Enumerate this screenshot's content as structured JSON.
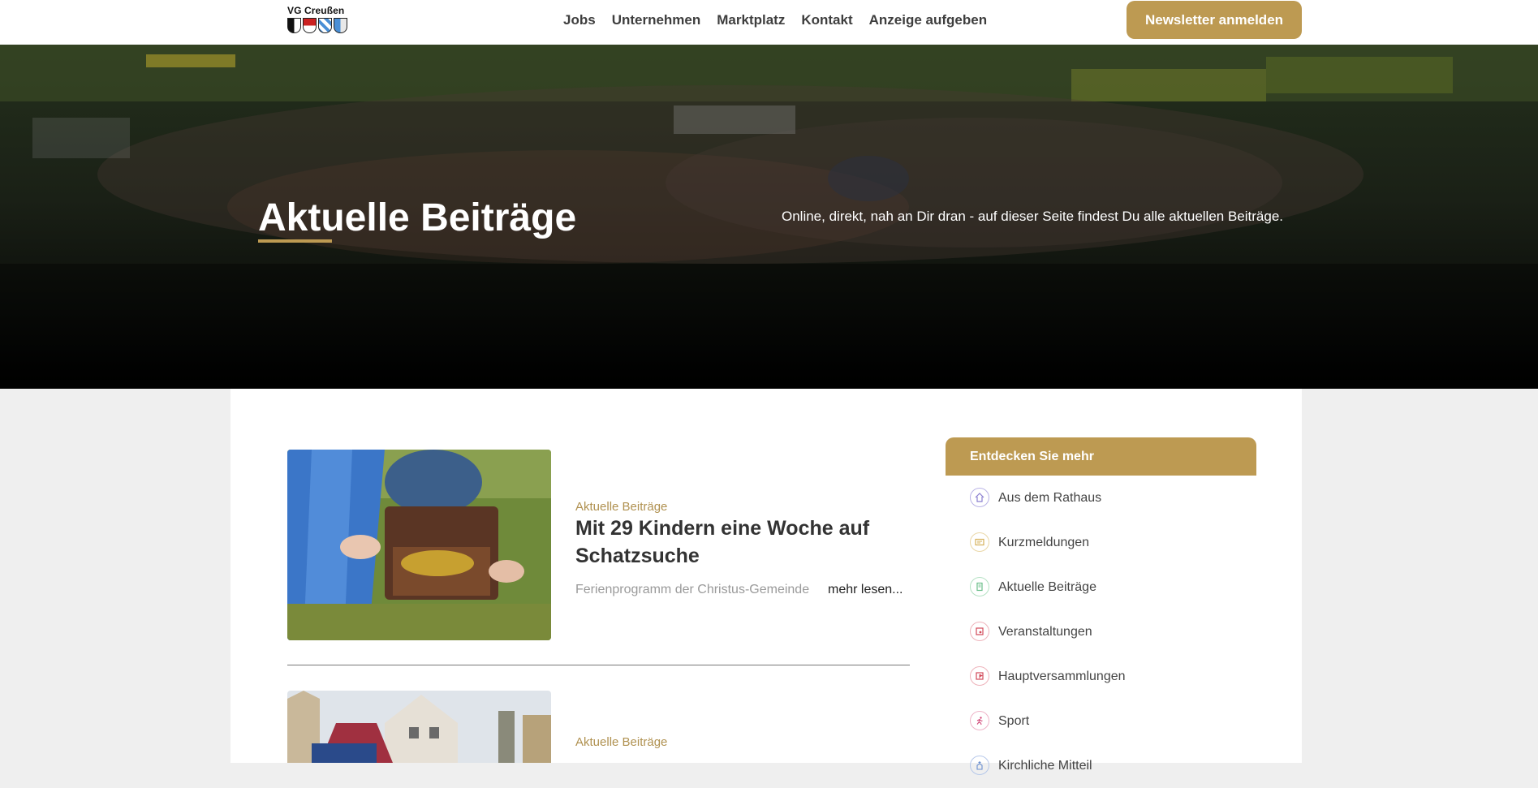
{
  "header": {
    "logo_text": "VG Creußen",
    "nav": [
      {
        "label": "Jobs"
      },
      {
        "label": "Unternehmen"
      },
      {
        "label": "Marktplatz"
      },
      {
        "label": "Kontakt"
      },
      {
        "label": "Anzeige aufgeben"
      }
    ],
    "newsletter_label": "Newsletter anmelden"
  },
  "hero": {
    "title": "Aktuelle Beiträge",
    "subtitle": "Online, direkt, nah an Dir dran - auf dieser Seite findest Du alle aktuellen Beiträge."
  },
  "posts": [
    {
      "category": "Aktuelle Beiträge",
      "title": "Mit 29 Kindern eine Woche auf Schatzsuche",
      "teaser": "Ferienprogramm der Christus-Gemeinde",
      "more": "mehr lesen..."
    },
    {
      "category": "Aktuelle Beiträge"
    }
  ],
  "sidebar": {
    "heading": "Entdecken Sie mehr",
    "items": [
      {
        "label": "Aus dem Rathaus",
        "icon": "house-icon",
        "color": "#8a7fd0"
      },
      {
        "label": "Kurzmeldungen",
        "icon": "newspaper-icon",
        "color": "#d6b15a"
      },
      {
        "label": "Aktuelle Beiträge",
        "icon": "document-icon",
        "color": "#6cbf8a"
      },
      {
        "label": "Veranstaltungen",
        "icon": "calendar-icon",
        "color": "#d24a5a"
      },
      {
        "label": "Hauptversammlungen",
        "icon": "calendar-flag-icon",
        "color": "#d24a5a"
      },
      {
        "label": "Sport",
        "icon": "runner-icon",
        "color": "#d24a7a"
      },
      {
        "label": "Kirchliche Mitteil",
        "icon": "church-icon",
        "color": "#6a8fd0"
      }
    ]
  }
}
